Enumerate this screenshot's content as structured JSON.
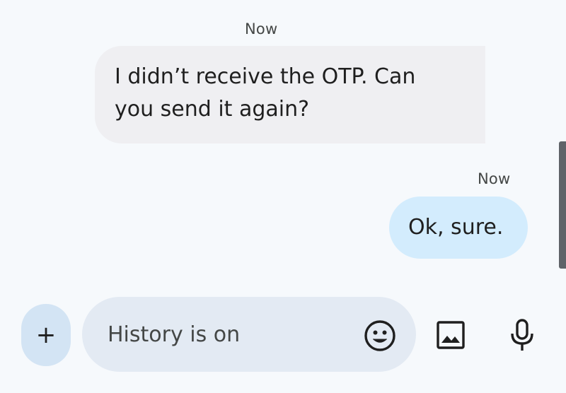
{
  "thread": {
    "messages": [
      {
        "direction": "incoming",
        "timestamp": "Now",
        "lines": [
          "I didn’t receive the OTP. Can",
          "you send it again?"
        ]
      },
      {
        "direction": "outgoing",
        "timestamp": "Now",
        "lines": [
          "Ok, sure."
        ]
      }
    ]
  },
  "composer": {
    "add_label": "+",
    "placeholder": "History is on",
    "icons": {
      "emoji": "emoji-smile-icon",
      "gallery": "image-gallery-icon",
      "voice": "microphone-icon"
    }
  },
  "colors": {
    "background": "#f6f9fc",
    "incoming_bubble": "#efeff2",
    "outgoing_bubble": "#d3ecfd",
    "composer_pill": "#e3eaf3",
    "add_button": "#d3e4f4",
    "text": "#1f1f1f",
    "muted_text": "#444746"
  }
}
